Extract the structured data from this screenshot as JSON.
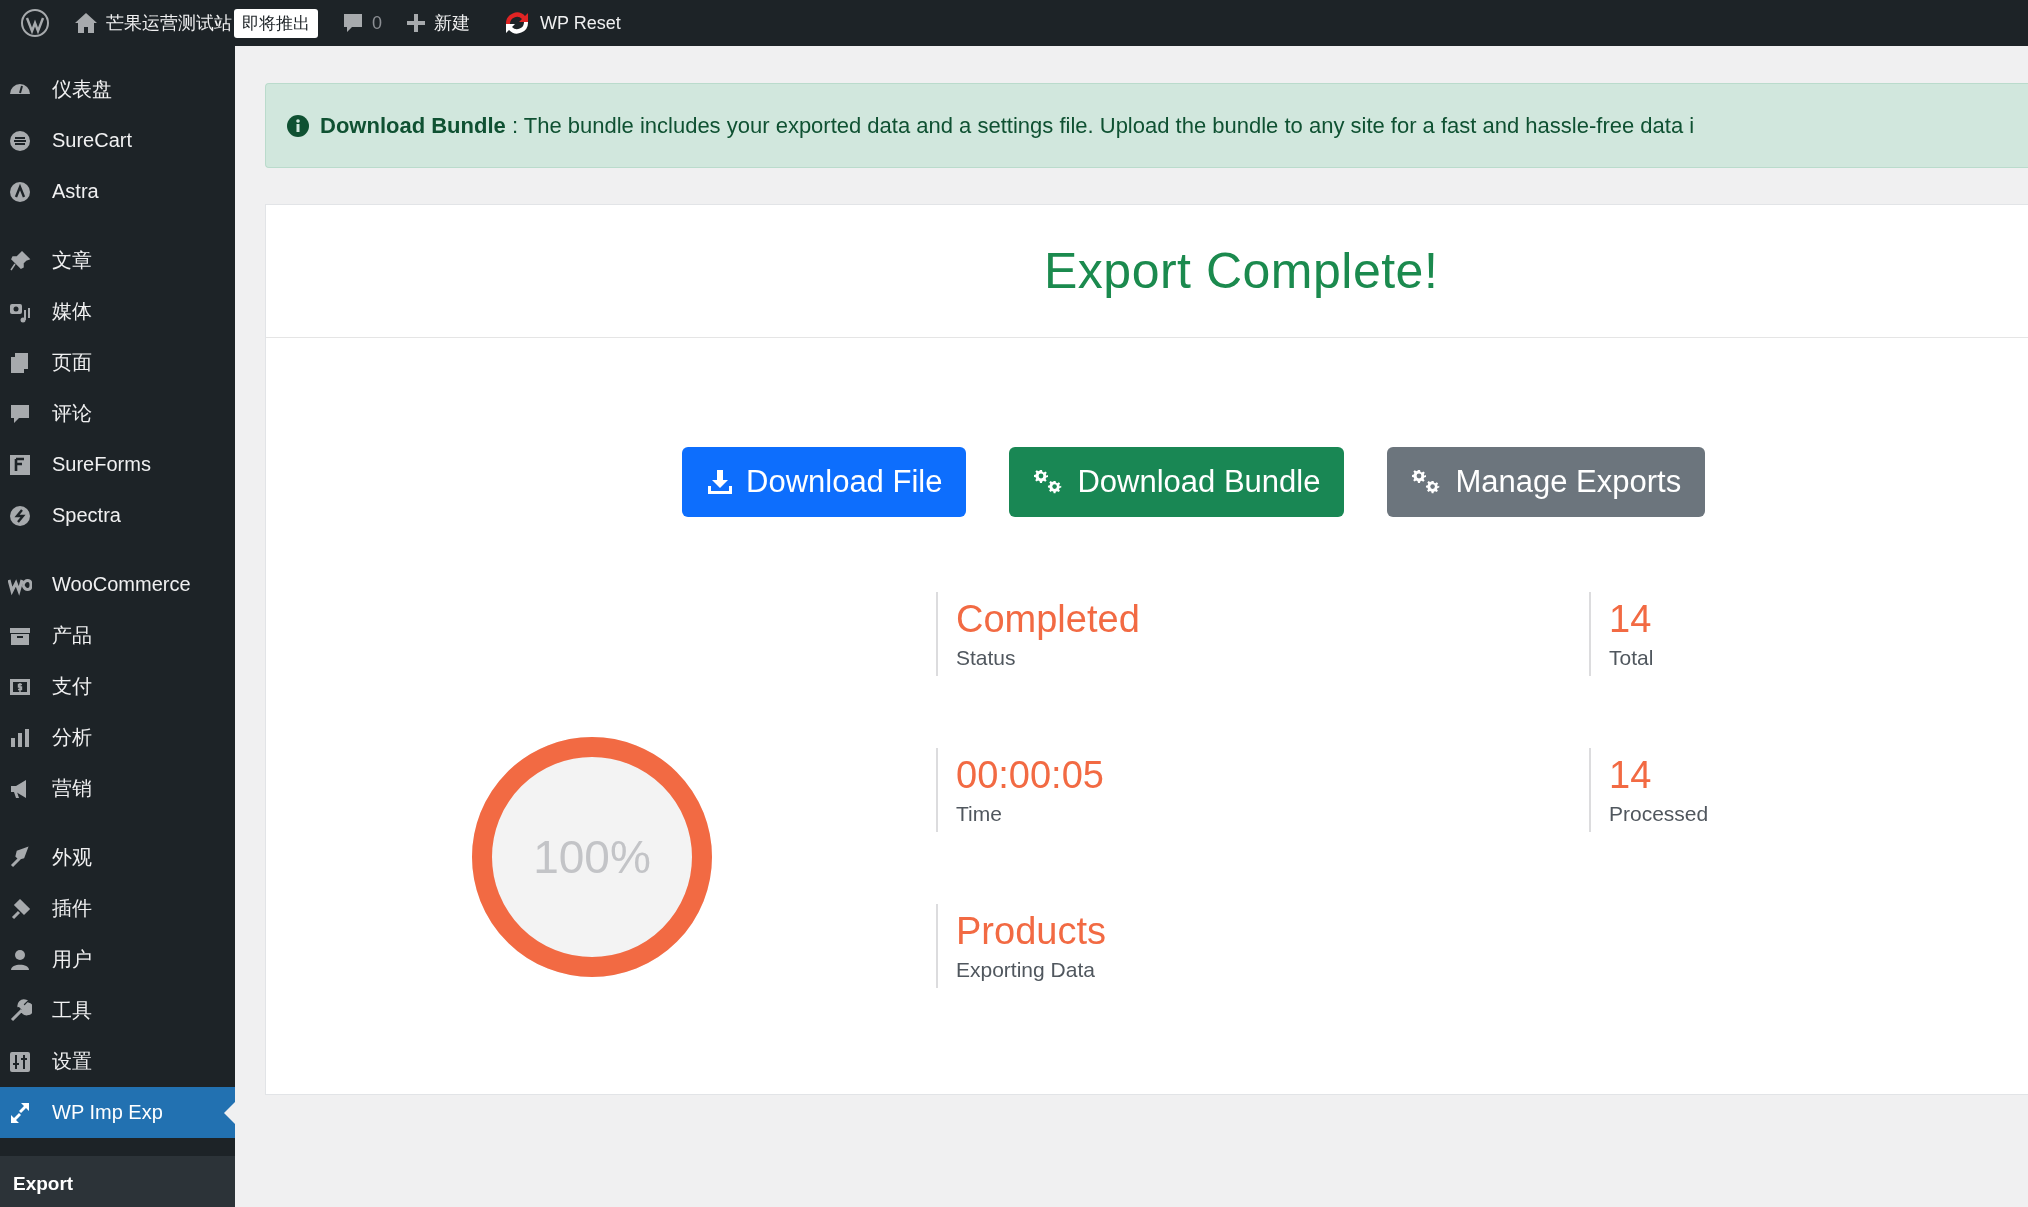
{
  "admin_bar": {
    "site_name": "芒果运营测试站",
    "badge": "即将推出",
    "comments": "0",
    "new_label": "新建",
    "plugin_label": "WP Reset"
  },
  "sidebar": {
    "groups": [
      [
        {
          "label": "仪表盘",
          "selected": false
        },
        {
          "label": "SureCart",
          "selected": false
        },
        {
          "label": "Astra",
          "selected": false
        }
      ],
      [
        {
          "label": "文章",
          "selected": false
        },
        {
          "label": "媒体",
          "selected": false
        },
        {
          "label": "页面",
          "selected": false
        },
        {
          "label": "评论",
          "selected": false
        },
        {
          "label": "SureForms",
          "selected": false
        },
        {
          "label": "Spectra",
          "selected": false
        }
      ],
      [
        {
          "label": "WooCommerce",
          "selected": false
        },
        {
          "label": "产品",
          "selected": false
        },
        {
          "label": "支付",
          "selected": false
        },
        {
          "label": "分析",
          "selected": false
        },
        {
          "label": "营销",
          "selected": false
        }
      ],
      [
        {
          "label": "外观",
          "selected": false
        },
        {
          "label": "插件",
          "selected": false
        },
        {
          "label": "用户",
          "selected": false
        },
        {
          "label": "工具",
          "selected": false
        },
        {
          "label": "设置",
          "selected": false
        },
        {
          "label": "WP Imp Exp",
          "selected": true
        }
      ]
    ],
    "submenu": [
      {
        "label": "Export",
        "selected": true
      }
    ]
  },
  "notice": {
    "text": "**Download Bundle** : The bundle includes your exported data and a settings file. Upload the bundle to any site for a fast and hassle-free data i"
  },
  "card": {
    "title": "Export Complete!",
    "buttons": [
      {
        "label": "Download File",
        "kind": "primary"
      },
      {
        "label": "Download Bundle",
        "kind": "success"
      },
      {
        "label": "Manage Exports",
        "kind": "secondary"
      }
    ],
    "progress": {
      "level": 1,
      "reading": "100%"
    },
    "stats": [
      {
        "value": "Completed",
        "label": "Status"
      },
      {
        "value": "14",
        "label": "Total"
      },
      {
        "value": "00:00:05",
        "label": "Time"
      },
      {
        "value": "14",
        "label": "Processed"
      },
      {
        "value": "Products",
        "label": "Exporting Data"
      }
    ]
  }
}
